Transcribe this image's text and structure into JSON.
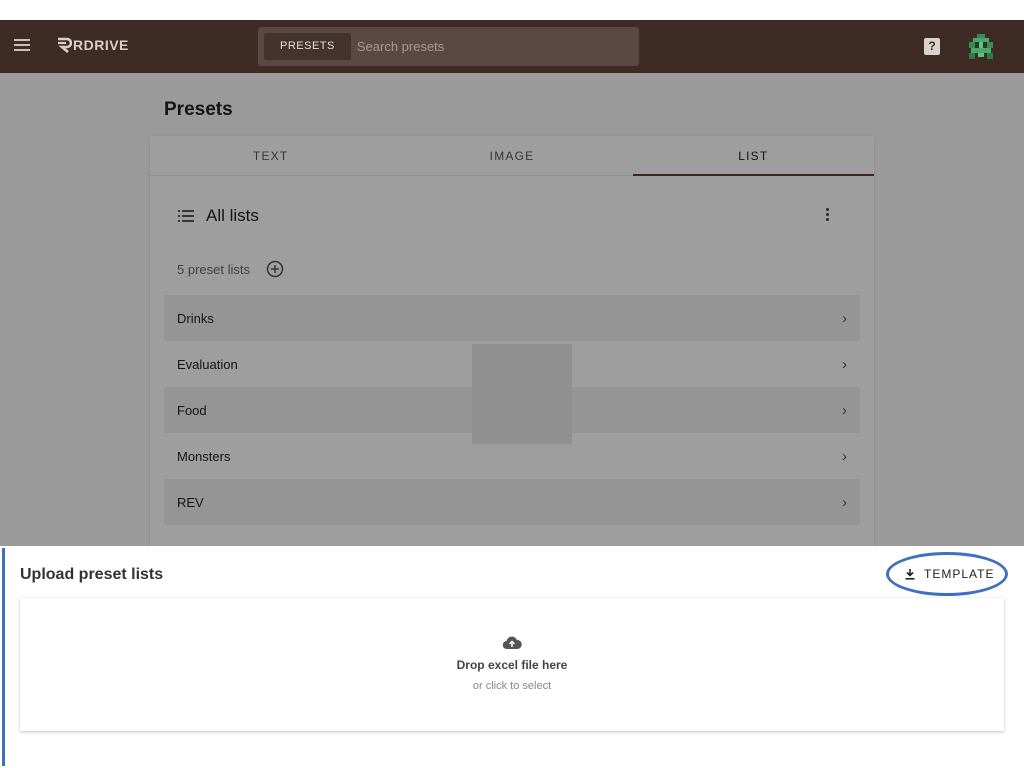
{
  "header": {
    "brand": "RDRIVE",
    "search_chip": "PRESETS",
    "search_placeholder": "Search presets",
    "help_label": "?"
  },
  "page": {
    "title": "Presets"
  },
  "tabs": [
    {
      "label": "TEXT",
      "active": false
    },
    {
      "label": "IMAGE",
      "active": false
    },
    {
      "label": "LIST",
      "active": true
    }
  ],
  "lists": {
    "header_title": "All lists",
    "count_label": "5 preset lists",
    "items": [
      {
        "label": "Drinks"
      },
      {
        "label": "Evaluation"
      },
      {
        "label": "Food"
      },
      {
        "label": "Monsters"
      },
      {
        "label": "REV"
      }
    ]
  },
  "upload": {
    "title": "Upload preset lists",
    "template_button": "TEMPLATE",
    "drop_title": "Drop excel file here",
    "drop_subtitle": "or click to select"
  },
  "colors": {
    "appbar": "#3e2b24",
    "accent": "#3f6fbf",
    "tab_indicator": "#5a3d33"
  }
}
